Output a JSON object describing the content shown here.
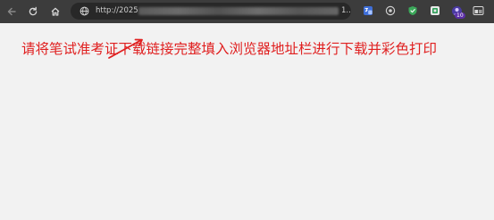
{
  "browser": {
    "url_prefix": "http://2025",
    "url_suffix": "1...",
    "url_aria": "address bar"
  },
  "toolbar": {
    "extension_badge": "10"
  },
  "annotation": {
    "text": "请将笔试准考证下载链接完整填入浏览器地址栏进行下载并彩色打印"
  },
  "colors": {
    "toolbar_bg": "#3c3c3c",
    "omnibox_bg": "#282828",
    "annotation": "#e02020",
    "page_bg": "#f2f2f2"
  }
}
